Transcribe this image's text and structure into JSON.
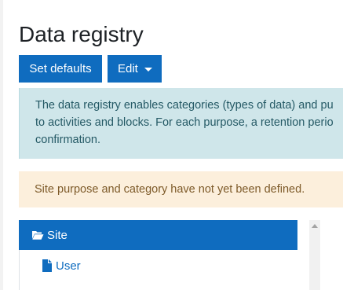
{
  "page": {
    "title": "Data registry"
  },
  "toolbar": {
    "set_defaults_label": "Set defaults",
    "edit_label": "Edit"
  },
  "info_alert": {
    "lines": [
      "The data registry enables categories (types of data) and pu",
      "to activities and blocks. For each purpose, a retention perio",
      "confirmation."
    ]
  },
  "warning_alert": {
    "text": "Site purpose and category have not yet been defined."
  },
  "tree": {
    "items": [
      {
        "label": "Site",
        "icon": "folder-open-icon",
        "selected": true
      },
      {
        "label": "User",
        "icon": "file-icon",
        "selected": false
      }
    ]
  },
  "colors": {
    "primary": "#0f6cbf",
    "info_bg": "#cfe6ea",
    "info_text": "#245965",
    "warning_bg": "#fcefdc",
    "warning_text": "#7d5a29"
  }
}
